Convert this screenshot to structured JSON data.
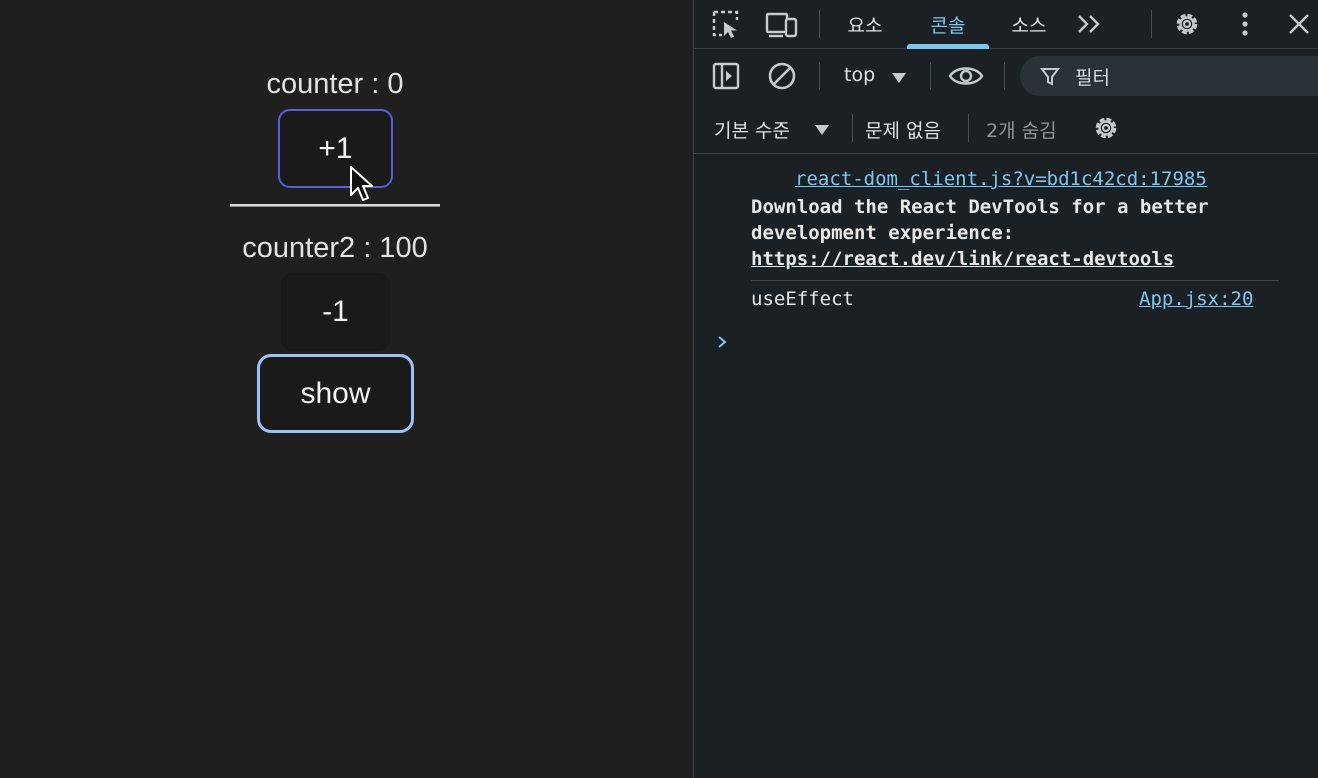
{
  "app": {
    "counter_label": "counter : 0",
    "plus_button": "+1",
    "counter2_label": "counter2 : 100",
    "minus_button": "-1",
    "show_button": "show"
  },
  "devtools": {
    "tabs": [
      {
        "label": "요소"
      },
      {
        "label": "콘솔"
      },
      {
        "label": "소스"
      }
    ],
    "active_tab": "콘솔",
    "toolbar": {
      "context": "top",
      "filter_placeholder": "필터",
      "level": "기본 수준",
      "issues": "문제 없음",
      "hidden": "2개 숨김"
    },
    "console": {
      "messages": [
        {
          "source": "react-dom_client.js?v=bd1c42cd:17985",
          "line1": "Download the React DevTools for a better",
          "line2": "development experience:",
          "link": "https://react.dev/link/react-devtools"
        },
        {
          "text": "useEffect",
          "source": "App.jsx:20"
        }
      ]
    },
    "icons": [
      "inspect-element-icon",
      "device-toolbar-icon",
      "more-tabs-icon",
      "settings-icon",
      "kebab-menu-icon",
      "close-icon",
      "sidebar-toggle-icon",
      "clear-console-icon",
      "eye-icon",
      "filter-icon",
      "console-settings-icon",
      "prompt-chevron-icon"
    ]
  },
  "colors": {
    "page_bg": "#1f1f1f",
    "devtools_bg": "#1b2024",
    "accent": "#7cc8ef",
    "focus_ring": "#9cc2f5",
    "hover_border": "#5b5fd6"
  }
}
